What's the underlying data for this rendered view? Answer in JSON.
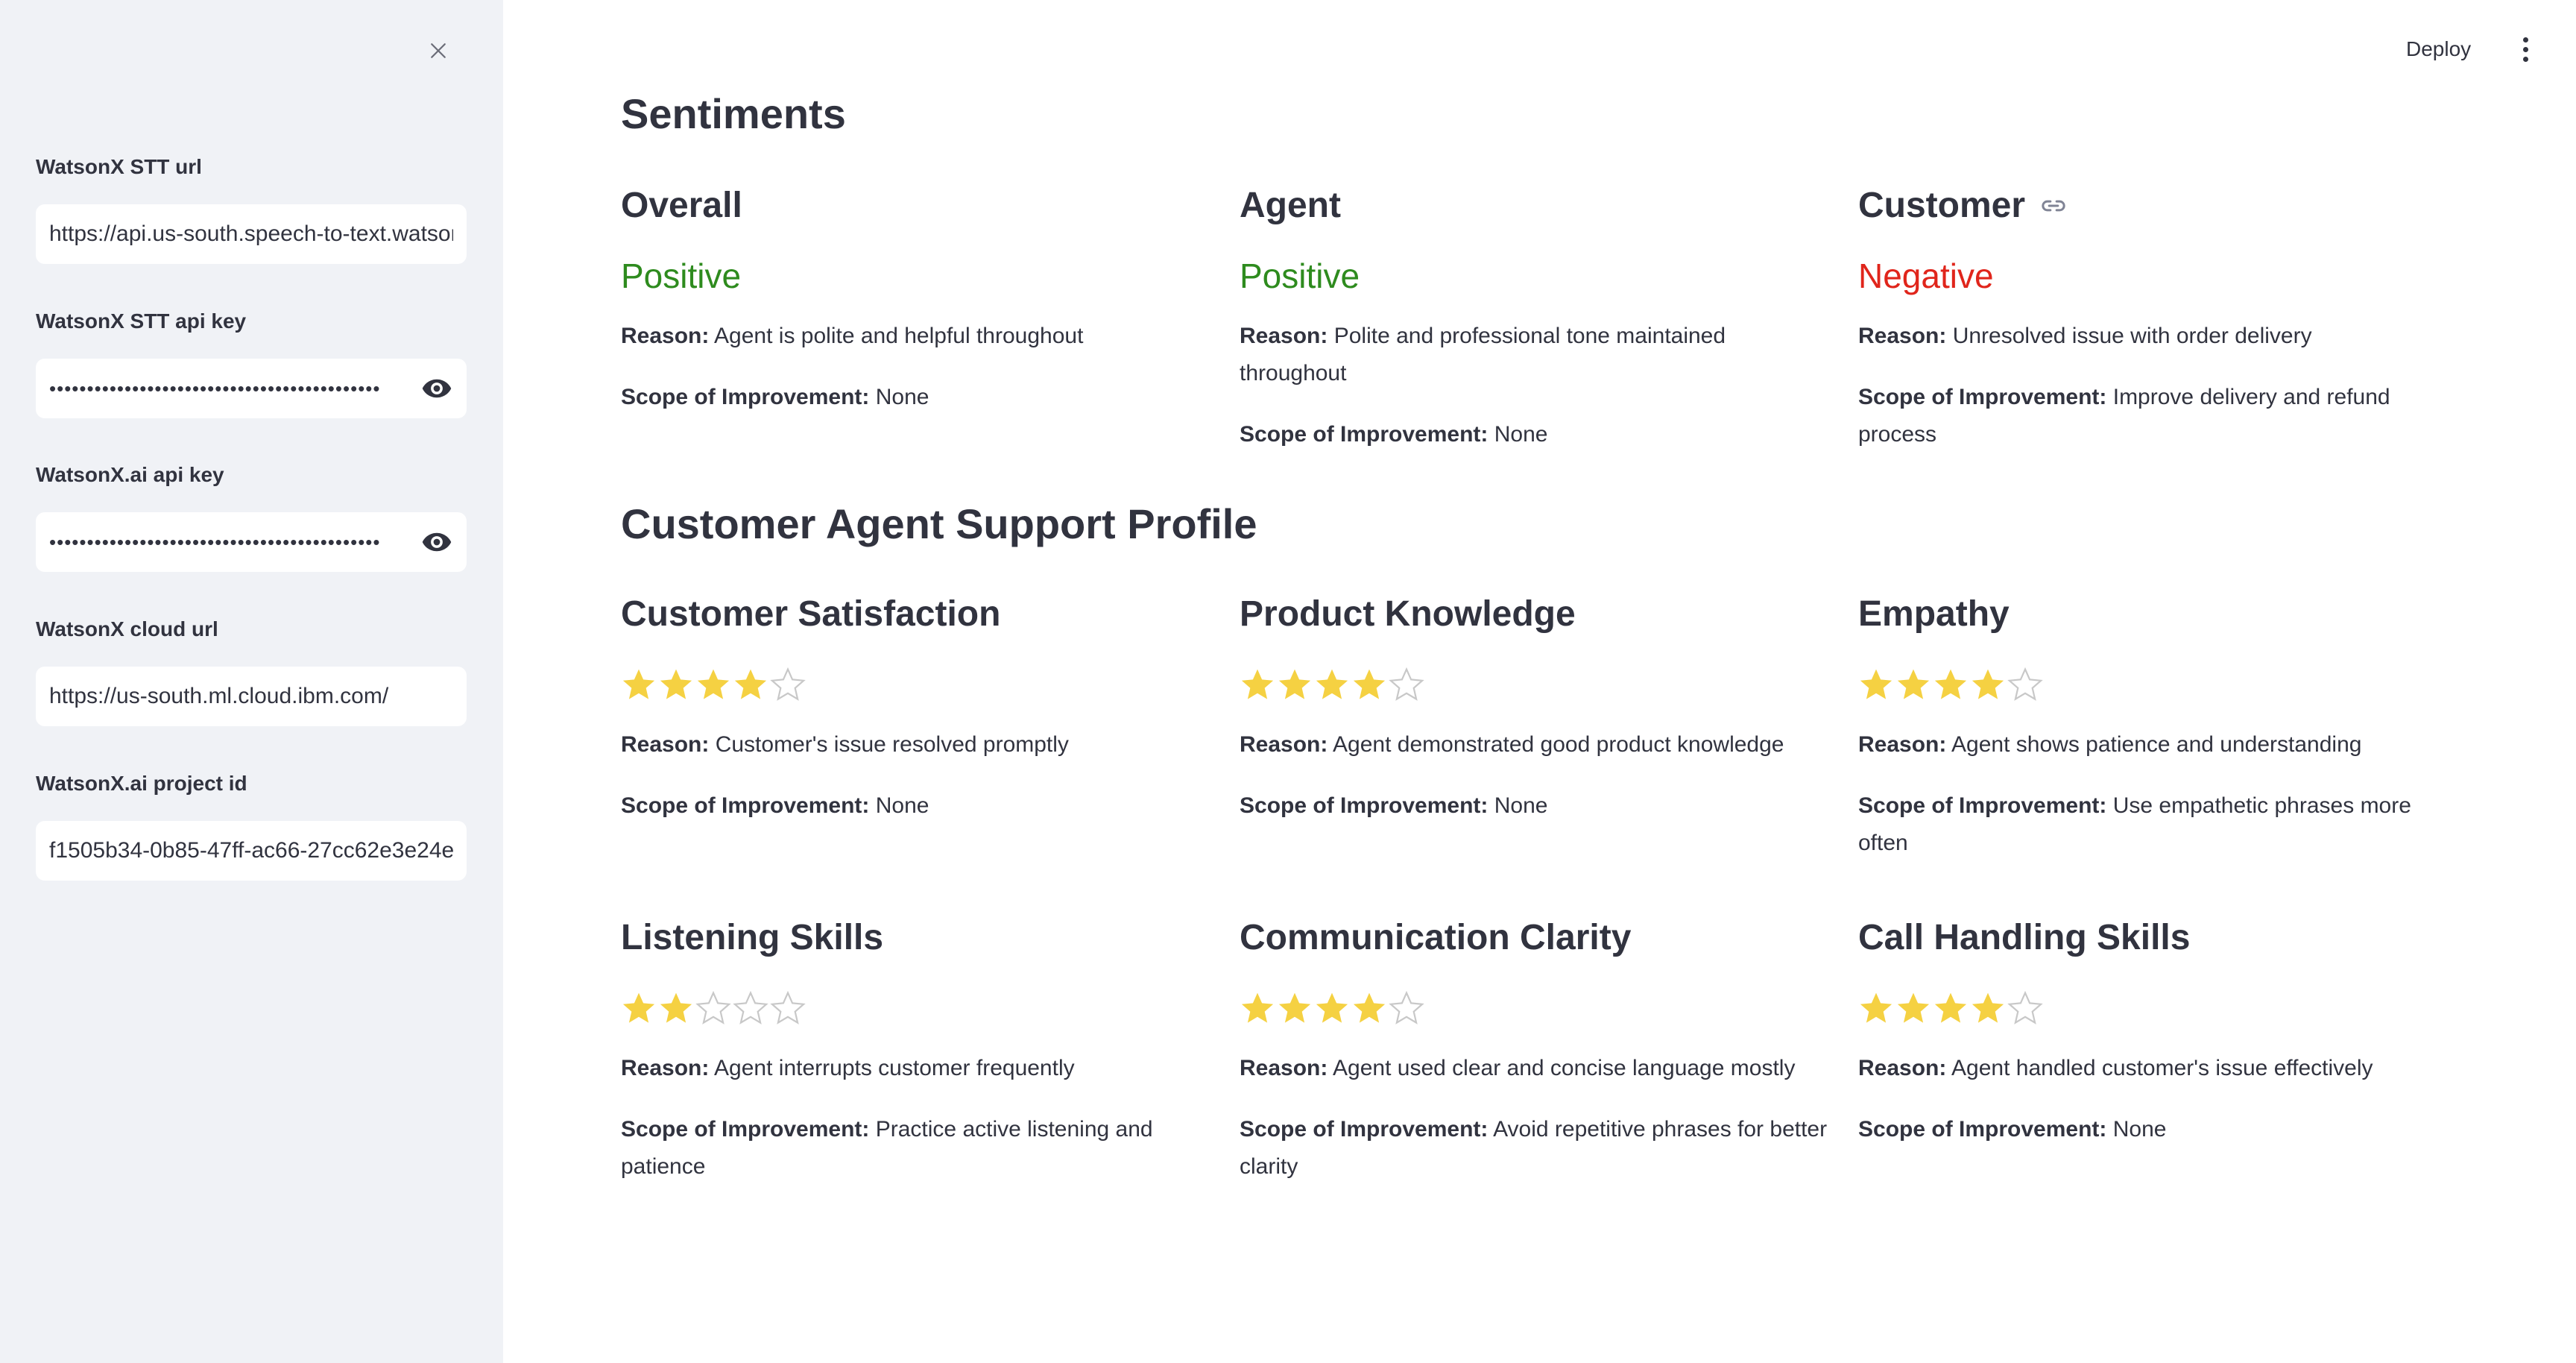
{
  "sidebar": {
    "fields": [
      {
        "label": "WatsonX STT url",
        "value": "https://api.us-south.speech-to-text.watson.cloud.ibm.com",
        "type": "text"
      },
      {
        "label": "WatsonX STT api key",
        "value": "••••••••••••••••••••••••••••••••••••••••••••",
        "type": "password"
      },
      {
        "label": "WatsonX.ai api key",
        "value": "••••••••••••••••••••••••••••••••••••••••••••",
        "type": "password"
      },
      {
        "label": "WatsonX cloud url",
        "value": "https://us-south.ml.cloud.ibm.com/",
        "type": "text"
      },
      {
        "label": "WatsonX.ai project id",
        "value": "f1505b34-0b85-47ff-ac66-27cc62e3e24e",
        "type": "text"
      }
    ]
  },
  "header": {
    "deploy_label": "Deploy"
  },
  "colors": {
    "positive": "#2e8b1e",
    "negative": "#e0251b",
    "star": "#f5d142",
    "star_empty": "#c8c8c8"
  },
  "labels": {
    "reason": "Reason:",
    "scope": "Scope of Improvement:"
  },
  "sentiments": {
    "title": "Sentiments",
    "items": [
      {
        "heading": "Overall",
        "sentiment": "Positive",
        "polarity": "positive",
        "reason": "Agent is polite and helpful throughout",
        "scope": "None"
      },
      {
        "heading": "Agent",
        "sentiment": "Positive",
        "polarity": "positive",
        "reason": "Polite and professional tone maintained throughout",
        "scope": "None"
      },
      {
        "heading": "Customer",
        "sentiment": "Negative",
        "polarity": "negative",
        "reason": "Unresolved issue with order delivery",
        "scope": "Improve delivery and refund process"
      }
    ]
  },
  "profile": {
    "title": "Customer Agent Support Profile",
    "items": [
      {
        "heading": "Customer Satisfaction",
        "rating": 4,
        "max": 5,
        "reason": "Customer's issue resolved promptly",
        "scope": "None"
      },
      {
        "heading": "Product Knowledge",
        "rating": 4,
        "max": 5,
        "reason": "Agent demonstrated good product knowledge",
        "scope": "None"
      },
      {
        "heading": "Empathy",
        "rating": 4,
        "max": 5,
        "reason": "Agent shows patience and understanding",
        "scope": "Use empathetic phrases more often"
      },
      {
        "heading": "Listening Skills",
        "rating": 2,
        "max": 5,
        "reason": "Agent interrupts customer frequently",
        "scope": "Practice active listening and patience"
      },
      {
        "heading": "Communication Clarity",
        "rating": 4,
        "max": 5,
        "reason": "Agent used clear and concise language mostly",
        "scope": "Avoid repetitive phrases for better clarity"
      },
      {
        "heading": "Call Handling Skills",
        "rating": 4,
        "max": 5,
        "reason": "Agent handled customer's issue effectively",
        "scope": "None"
      }
    ]
  }
}
